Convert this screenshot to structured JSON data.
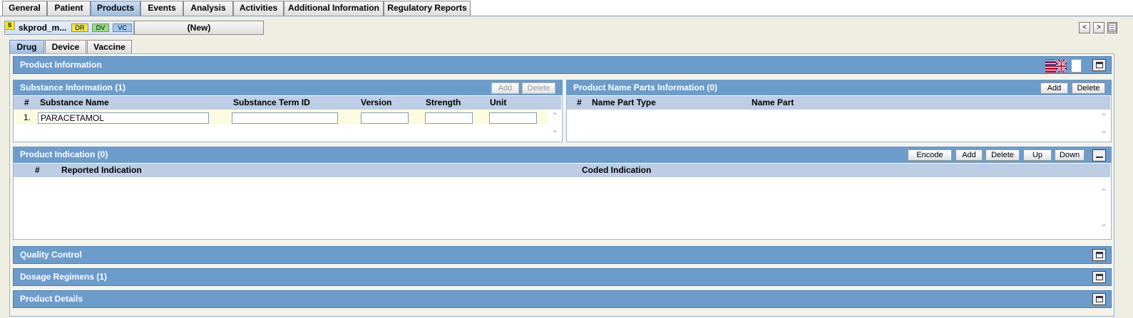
{
  "top_tabs": [
    "General",
    "Patient",
    "Products",
    "Events",
    "Analysis",
    "Activities",
    "Additional Information",
    "Regulatory Reports"
  ],
  "product_tab": {
    "flag": "S",
    "name": "skprod_m...",
    "badges": [
      "DR",
      "DV",
      "VC"
    ],
    "badge_colors": [
      "#f2e44c",
      "#8fe07a",
      "#9ec8ee"
    ],
    "new_label": "(New)"
  },
  "nav": {
    "prev": "<",
    "next": ">"
  },
  "product_type_tabs": [
    "Drug",
    "Device",
    "Vaccine"
  ],
  "sections": {
    "product_information": "Product Information",
    "substance": {
      "title": "Substance Information (1)",
      "add": "Add",
      "delete": "Delete",
      "columns": [
        "#",
        "Substance Name",
        "Substance Term ID",
        "Version",
        "Strength",
        "Unit"
      ],
      "rows": [
        {
          "num": "1.",
          "substance_name": "PARACETAMOL",
          "term_id": "",
          "version": "",
          "strength": "",
          "unit": ""
        }
      ]
    },
    "name_parts": {
      "title": "Product Name Parts Information (0)",
      "add": "Add",
      "delete": "Delete",
      "columns": [
        "#",
        "Name Part Type",
        "Name Part"
      ]
    },
    "indication": {
      "title": "Product Indication (0)",
      "encode": "Encode",
      "add": "Add",
      "delete": "Delete",
      "up": "Up",
      "down": "Down",
      "columns": [
        "#",
        "Reported Indication",
        "Coded Indication"
      ]
    },
    "quality_control": "Quality Control",
    "dosage_regimens": "Dosage Regimens (1)",
    "product_details": "Product Details"
  },
  "colors": {
    "section_blue": "#6b9ccc",
    "grid_header": "#bccde4",
    "row_highlight": "#fdfbe0"
  }
}
